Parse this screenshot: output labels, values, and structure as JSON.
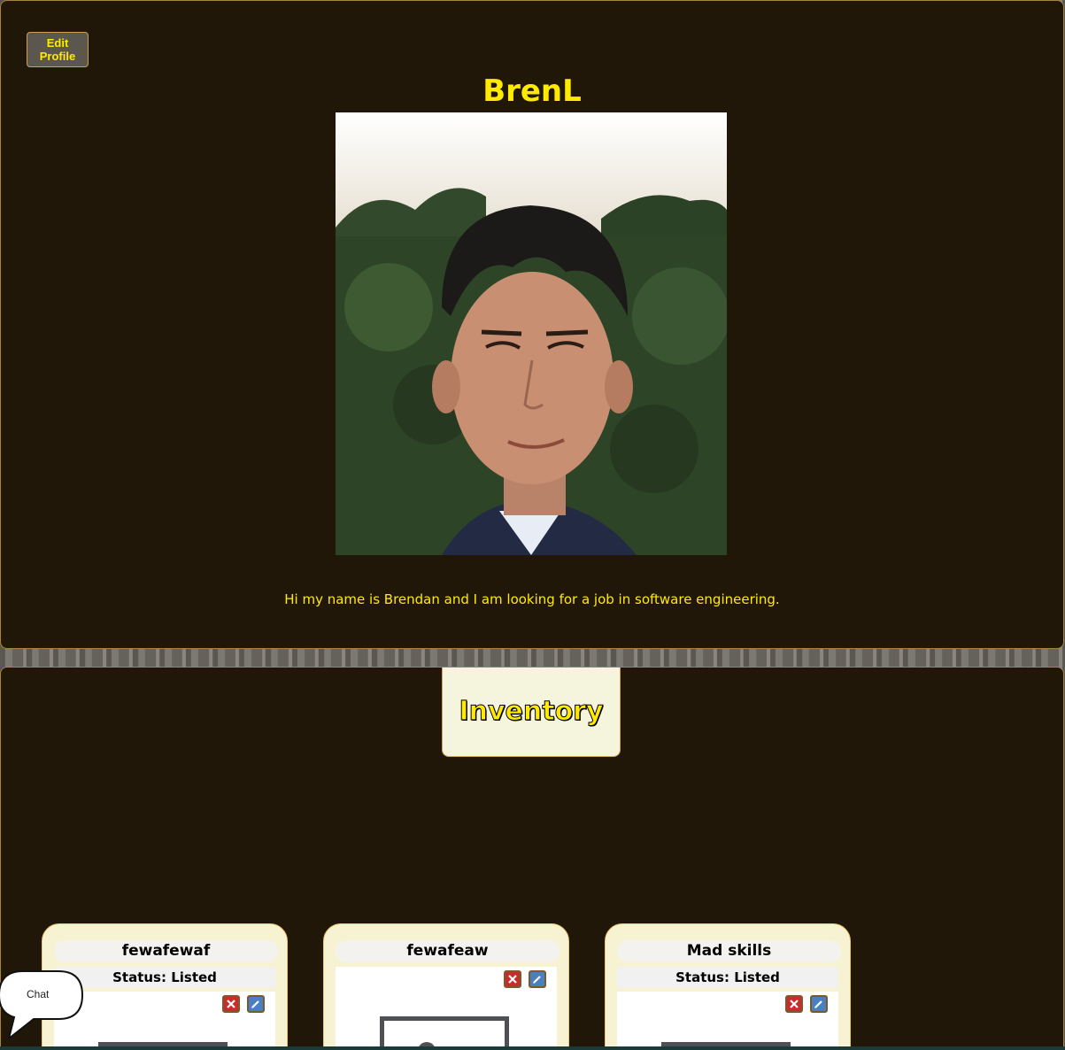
{
  "profile": {
    "edit_button_label": "Edit Profile",
    "username": "BrenL",
    "bio": "Hi my name is Brendan and I am looking for a job in software engineering."
  },
  "inventory": {
    "title": "Inventory",
    "items": [
      {
        "name": "fewafewaf",
        "status": "Status: Listed"
      },
      {
        "name": "fewafeaw",
        "status": ""
      },
      {
        "name": "Mad skills",
        "status": "Status: Listed"
      }
    ]
  },
  "chat": {
    "label": "Chat"
  },
  "colors": {
    "accent_yellow": "#ffea00",
    "panel_bg": "#211708",
    "card_bg": "#f7f3d2",
    "delete_red": "#c92c2c",
    "edit_blue": "#4a7fc1"
  },
  "icons": {
    "delete": "close-icon",
    "edit": "pencil-icon"
  }
}
